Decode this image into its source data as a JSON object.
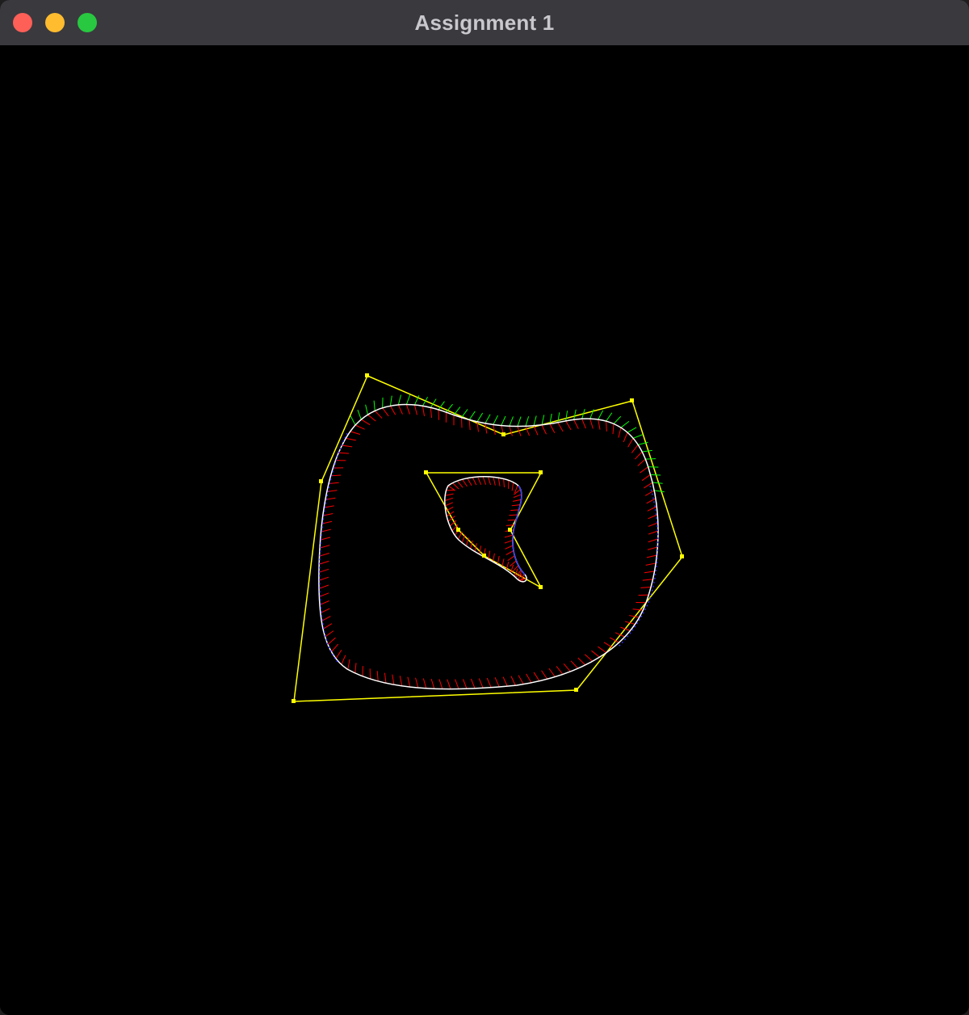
{
  "window": {
    "title": "Assignment 1"
  },
  "colors": {
    "background": "#000000",
    "control_polygon": "#ffff00",
    "curve": "#ffffff",
    "tangent": "#0000ff",
    "normal_inward": "#ff0000",
    "normal_outward": "#00ff00"
  },
  "icons": [
    "close-button",
    "minimize-button",
    "maximize-button"
  ]
}
